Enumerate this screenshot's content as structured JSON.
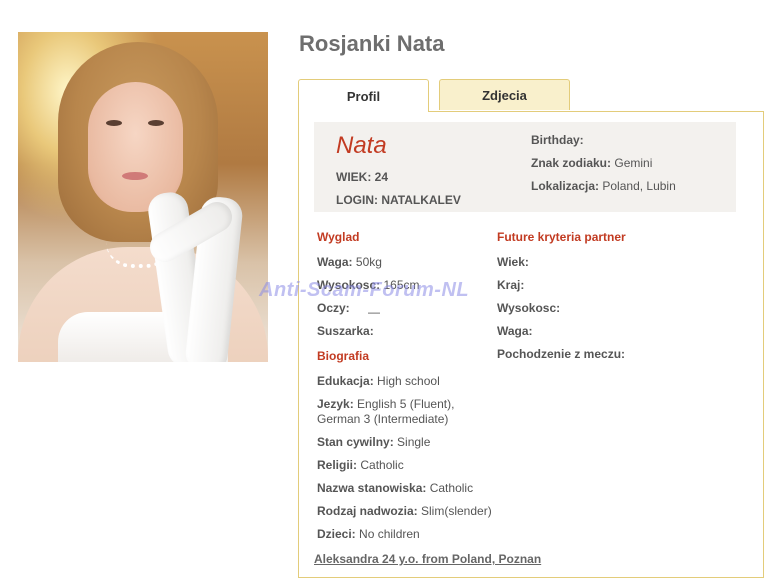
{
  "profile": {
    "title": "Rosjanki Nata"
  },
  "tabs": [
    {
      "label": "Profil"
    },
    {
      "label": "Zdjecia"
    }
  ],
  "header_box": {
    "name": "Nata",
    "age_label": "WIEK:",
    "age_value": "24",
    "login_label": "LOGIN:",
    "login_value": "NATALKALEV",
    "birthday_label": "Birthday:",
    "birthday_value": "",
    "zodiac_label": "Znak zodiaku:",
    "zodiac_value": "Gemini",
    "location_label": "Lokalizacja:",
    "location_value": "Poland, Lubin"
  },
  "appearance": {
    "heading": "Wyglad",
    "rows": [
      {
        "label": "Waga:",
        "value": "50kg"
      },
      {
        "label": "Wysokosc:",
        "value": "165cm"
      },
      {
        "label": "Oczy:",
        "value": ""
      },
      {
        "label": "Suszarka:",
        "value": ""
      }
    ]
  },
  "partner": {
    "heading": "Future kryteria partner",
    "rows": [
      {
        "label": "Wiek:",
        "value": ""
      },
      {
        "label": "Kraj:",
        "value": ""
      },
      {
        "label": "Wysokosc:",
        "value": ""
      },
      {
        "label": "Waga:",
        "value": ""
      },
      {
        "label": "Pochodzenie z meczu:",
        "value": ""
      }
    ]
  },
  "biography": {
    "heading": "Biografia",
    "rows": [
      {
        "label": "Edukacja:",
        "value": "High school"
      },
      {
        "label": "Jezyk:",
        "value": "English 5 (Fluent),",
        "value2": "German 3 (Intermediate)"
      },
      {
        "label": "Stan cywilny:",
        "value": "Single"
      },
      {
        "label": "Religii:",
        "value": "Catholic"
      },
      {
        "label": "Nazwa stanowiska:",
        "value": "Catholic"
      },
      {
        "label": "Rodzaj nadwozia:",
        "value": "Slim(slender)"
      },
      {
        "label": "Dzieci:",
        "value": "No children"
      }
    ]
  },
  "footer_link": "Aleksandra 24 y.o. from Poland, Poznan",
  "watermark": "Anti-Scam-Forum-NL",
  "colors": {
    "accent_red": "#c23b22",
    "tab_border": "#e3cc7a",
    "tab_inactive_bg": "#f9f0cc",
    "info_bg": "#f3f1ee"
  }
}
